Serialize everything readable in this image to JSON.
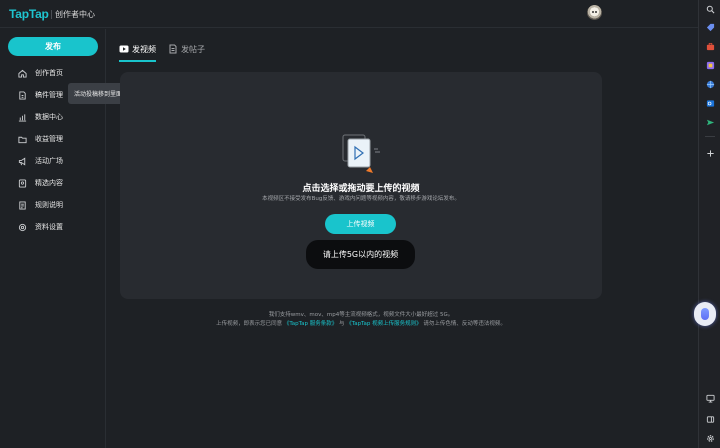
{
  "header": {
    "brand": "TapTap",
    "subtitle": "创作者中心"
  },
  "sidebar": {
    "publish_label": "发布",
    "items": [
      {
        "label": "创作首页",
        "icon": "home-icon"
      },
      {
        "label": "稿件管理",
        "icon": "document-icon"
      },
      {
        "label": "数据中心",
        "icon": "bar-chart-icon"
      },
      {
        "label": "收益管理",
        "icon": "folder-icon"
      },
      {
        "label": "活动广场",
        "icon": "megaphone-icon"
      },
      {
        "label": "精选内容",
        "icon": "badge-icon"
      },
      {
        "label": "规则说明",
        "icon": "rules-icon"
      },
      {
        "label": "资料设置",
        "icon": "settings-icon"
      }
    ]
  },
  "tooltip": {
    "text": "活动投稿移到里面了",
    "close": "×"
  },
  "tabs": [
    {
      "label": "发视频",
      "icon": "video-icon",
      "active": true
    },
    {
      "label": "发帖子",
      "icon": "post-icon",
      "active": false
    }
  ],
  "upload": {
    "title": "点击选择或拖动要上传的视频",
    "description": "本视频区不接受发布Bug反馈、游戏内问题等视频内容，敬请移步游戏论坛发布。",
    "button_label": "上传视频",
    "size_tip": "请上传5G以内的视频"
  },
  "footer": {
    "line1": "我们支持wmv、mov、mp4等主流视频格式，视频文件大小最好超过 5G。",
    "line2_prefix": "上传视频，即表示您已同意",
    "link1": "《TapTap 服务条款》",
    "line2_mid": "与",
    "link2": "《TapTap 视频上传服务规则》",
    "line2_suffix": "请勿上传色情、反动等违法视频。"
  },
  "rightbar": {
    "icons": [
      "search-icon",
      "tag-icon",
      "toolbox-icon",
      "puzzle-icon",
      "globe-icon",
      "outlook-icon",
      "send-icon",
      "plus-icon",
      "screen-icon",
      "window-icon",
      "gear-icon"
    ]
  },
  "colors": {
    "accent": "#19c4cc",
    "background": "#1e2125",
    "panel": "#282b30"
  }
}
